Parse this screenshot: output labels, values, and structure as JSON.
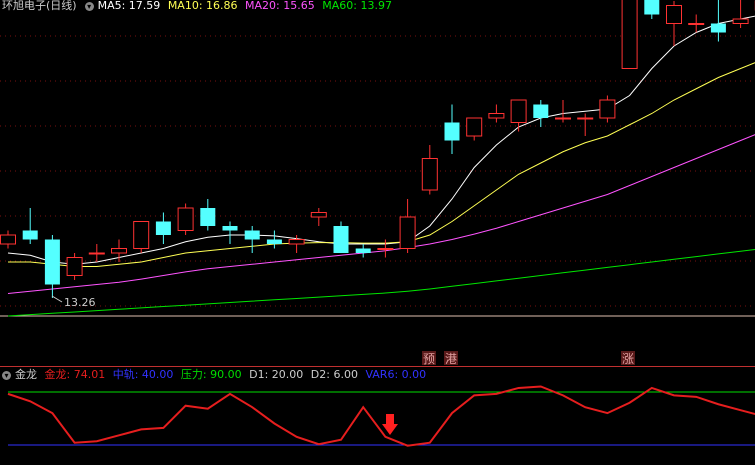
{
  "main_header": {
    "title": "环旭电子(日线)",
    "ma5": "MA5: 17.59",
    "ma10": "MA10: 16.86",
    "ma20": "MA20: 15.65",
    "ma60": "MA60: 13.97"
  },
  "low_label": "13.26",
  "signals": [
    "预",
    "港",
    "涨"
  ],
  "indicator_header": {
    "name": "金龙",
    "jinlong": "金龙: 74.01",
    "zhonggui": "中轨: 40.00",
    "yali": "压力: 90.00",
    "d1": "D1: 20.00",
    "d2": "D2: 6.00",
    "var6": "VAR6: 0.00"
  },
  "colors": {
    "up": "#ff3232",
    "down": "#54ffff",
    "ma5": "#ffffff",
    "ma10": "#ffff54",
    "ma20": "#ff54ff",
    "ma60": "#00e600",
    "jinlong": "#e61e1e",
    "zhonggui": "#3232ff",
    "yali": "#00dc00",
    "signal": "#e0a0a0"
  },
  "candles": [
    {
      "o": 14.5,
      "c": 14.7,
      "h": 14.8,
      "l": 14.4
    },
    {
      "o": 14.8,
      "c": 14.6,
      "h": 15.3,
      "l": 14.5
    },
    {
      "o": 14.6,
      "c": 13.6,
      "h": 14.7,
      "l": 13.3
    },
    {
      "o": 13.8,
      "c": 14.2,
      "h": 14.3,
      "l": 13.7
    },
    {
      "o": 14.3,
      "c": 14.3,
      "h": 14.5,
      "l": 14.1
    },
    {
      "o": 14.3,
      "c": 14.4,
      "h": 14.6,
      "l": 14.1
    },
    {
      "o": 14.4,
      "c": 15.0,
      "h": 15.0,
      "l": 14.3
    },
    {
      "o": 15.0,
      "c": 14.7,
      "h": 15.2,
      "l": 14.5
    },
    {
      "o": 14.8,
      "c": 15.3,
      "h": 15.4,
      "l": 14.7
    },
    {
      "o": 15.3,
      "c": 14.9,
      "h": 15.5,
      "l": 14.8
    },
    {
      "o": 14.9,
      "c": 14.8,
      "h": 15.0,
      "l": 14.5
    },
    {
      "o": 14.8,
      "c": 14.6,
      "h": 14.9,
      "l": 14.3
    },
    {
      "o": 14.6,
      "c": 14.5,
      "h": 14.8,
      "l": 14.4
    },
    {
      "o": 14.5,
      "c": 14.6,
      "h": 14.7,
      "l": 14.3
    },
    {
      "o": 15.1,
      "c": 15.2,
      "h": 15.3,
      "l": 14.9
    },
    {
      "o": 14.9,
      "c": 14.3,
      "h": 15.0,
      "l": 14.3
    },
    {
      "o": 14.4,
      "c": 14.3,
      "h": 14.5,
      "l": 14.2
    },
    {
      "o": 14.4,
      "c": 14.4,
      "h": 14.6,
      "l": 14.2
    },
    {
      "o": 14.4,
      "c": 15.1,
      "h": 15.5,
      "l": 14.3
    },
    {
      "o": 15.7,
      "c": 16.4,
      "h": 16.7,
      "l": 15.6
    },
    {
      "o": 17.2,
      "c": 16.8,
      "h": 17.6,
      "l": 16.5
    },
    {
      "o": 16.9,
      "c": 17.3,
      "h": 17.3,
      "l": 16.8
    },
    {
      "o": 17.3,
      "c": 17.4,
      "h": 17.6,
      "l": 17.2
    },
    {
      "o": 17.2,
      "c": 17.7,
      "h": 17.7,
      "l": 17.0
    },
    {
      "o": 17.6,
      "c": 17.3,
      "h": 17.7,
      "l": 17.1
    },
    {
      "o": 17.3,
      "c": 17.3,
      "h": 17.7,
      "l": 17.2
    },
    {
      "o": 17.3,
      "c": 17.3,
      "h": 17.4,
      "l": 16.9
    },
    {
      "o": 17.3,
      "c": 17.7,
      "h": 17.8,
      "l": 17.2
    },
    {
      "o": 18.4,
      "c": 20.1,
      "h": 20.1,
      "l": 18.4
    },
    {
      "o": 20.3,
      "c": 19.6,
      "h": 20.3,
      "l": 19.5
    },
    {
      "o": 19.4,
      "c": 19.8,
      "h": 19.9,
      "l": 18.9
    },
    {
      "o": 19.4,
      "c": 19.4,
      "h": 19.6,
      "l": 19.2
    },
    {
      "o": 19.4,
      "c": 19.2,
      "h": 20.3,
      "l": 19.0
    },
    {
      "o": 19.4,
      "c": 19.5,
      "h": 20.0,
      "l": 19.3
    },
    {
      "o": 19.7,
      "c": 19.9,
      "h": 20.0,
      "l": 19.6
    }
  ],
  "ma_lines": {
    "ma5": [
      14.3,
      14.25,
      14.1,
      14.05,
      14.1,
      14.2,
      14.3,
      14.4,
      14.55,
      14.65,
      14.7,
      14.7,
      14.68,
      14.62,
      14.55,
      14.5,
      14.5,
      14.5,
      14.55,
      14.9,
      15.5,
      16.2,
      16.7,
      17.1,
      17.3,
      17.4,
      17.45,
      17.5,
      17.8,
      18.4,
      18.9,
      19.2,
      19.4,
      19.5,
      19.6
    ],
    "ma10": [
      14.1,
      14.1,
      14.05,
      14.0,
      14.0,
      14.05,
      14.1,
      14.2,
      14.3,
      14.35,
      14.4,
      14.45,
      14.5,
      14.52,
      14.53,
      14.53,
      14.52,
      14.52,
      14.55,
      14.7,
      15.0,
      15.35,
      15.7,
      16.05,
      16.3,
      16.55,
      16.75,
      16.9,
      17.15,
      17.4,
      17.7,
      17.95,
      18.2,
      18.4,
      18.6
    ],
    "ma20": [
      13.4,
      13.45,
      13.5,
      13.55,
      13.6,
      13.65,
      13.72,
      13.8,
      13.88,
      13.95,
      14.0,
      14.05,
      14.1,
      14.15,
      14.2,
      14.25,
      14.3,
      14.35,
      14.42,
      14.5,
      14.6,
      14.72,
      14.85,
      15.0,
      15.15,
      15.3,
      15.45,
      15.6,
      15.8,
      16.0,
      16.2,
      16.4,
      16.6,
      16.8,
      17.0
    ],
    "ma60": [
      12.9,
      12.93,
      12.96,
      12.99,
      13.02,
      13.05,
      13.08,
      13.11,
      13.14,
      13.17,
      13.2,
      13.23,
      13.26,
      13.29,
      13.32,
      13.35,
      13.38,
      13.41,
      13.45,
      13.5,
      13.56,
      13.62,
      13.68,
      13.74,
      13.8,
      13.86,
      13.92,
      13.98,
      14.04,
      14.1,
      14.16,
      14.22,
      14.28,
      14.34,
      14.4
    ]
  },
  "jinlong_series": [
    88,
    78,
    62,
    22,
    24,
    32,
    40,
    42,
    72,
    68,
    88,
    70,
    48,
    30,
    20,
    26,
    70,
    30,
    18,
    22,
    62,
    86,
    88,
    96,
    98,
    86,
    70,
    62,
    76,
    96,
    86,
    84,
    74,
    66,
    58
  ]
}
